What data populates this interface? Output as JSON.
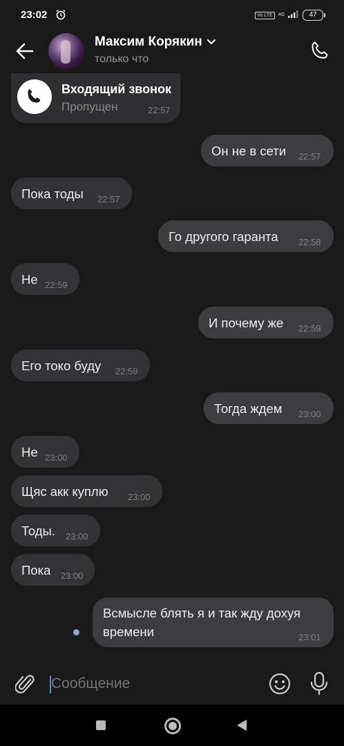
{
  "status_bar": {
    "time": "23:02",
    "volte": "Vo LTE",
    "network": "4G",
    "battery": "47"
  },
  "header": {
    "name": "Максим Корякин",
    "status": "только что"
  },
  "call_card": {
    "title": "Входящий звонок",
    "subtitle": "Пропущен",
    "time": "22:57"
  },
  "messages": [
    {
      "dir": "out",
      "text": "Он не в сети",
      "time": "22:57"
    },
    {
      "dir": "in",
      "text": "Пока тоды",
      "time": "22:57"
    },
    {
      "dir": "out",
      "text": "Го другого гаранта",
      "time": "22:58"
    },
    {
      "dir": "in",
      "text": "Не",
      "time": "22:59"
    },
    {
      "dir": "out",
      "text": "И почему же",
      "time": "22:59"
    },
    {
      "dir": "in",
      "text": "Его токо буду",
      "time": "22:59"
    },
    {
      "dir": "out",
      "text": "Тогда ждем",
      "time": "23:00"
    },
    {
      "dir": "in",
      "text": "Не",
      "time": "23:00"
    },
    {
      "dir": "in",
      "text": "Щяс акк куплю",
      "time": "23:00"
    },
    {
      "dir": "in",
      "text": "Тоды.",
      "time": "23:00"
    },
    {
      "dir": "in",
      "text": "Пока",
      "time": "23:00"
    },
    {
      "dir": "out",
      "text_line1": "Всмысле блять я и так жду дохуя",
      "text_line2": "времени",
      "time": "23:01"
    }
  ],
  "input": {
    "placeholder": "Сообщение"
  },
  "icons": {
    "back": "arrow-left-icon",
    "call": "phone-icon",
    "attach": "paperclip-icon",
    "emoji": "smiley-icon",
    "mic": "microphone-icon"
  },
  "colors": {
    "background": "#19191a",
    "bubble_in": "#333335",
    "bubble_out": "#3d3d40",
    "unread_dot": "#8aa8d8"
  }
}
